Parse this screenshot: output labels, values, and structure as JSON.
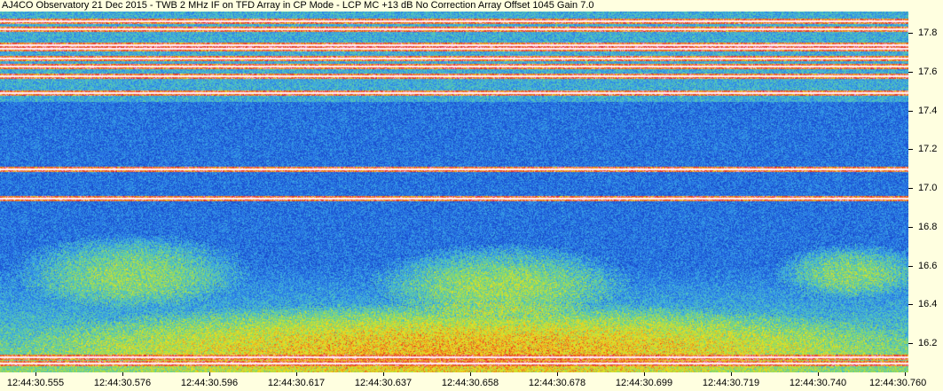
{
  "title": "AJ4CO Observatory 21 Dec 2015 - TWB 2 MHz IF on TFD Array in CP Mode - LCP  MC +13 dB  No Correction Array  Offset 1045  Gain 7.0",
  "chart_data": {
    "type": "heatmap",
    "title": "AJ4CO Observatory 21 Dec 2015 - TWB 2 MHz IF on TFD Array in CP Mode - LCP  MC +13 dB  No Correction Array  Offset 1045  Gain 7.0",
    "xlabel": "",
    "ylabel": "",
    "x_tick_labels": [
      "12:44:30.555",
      "12:44:30.576",
      "12:44:30.596",
      "12:44:30.617",
      "12:44:30.637",
      "12:44:30.658",
      "12:44:30.678",
      "12:44:30.699",
      "12:44:30.719",
      "12:44:30.740",
      "12:44:30.760"
    ],
    "y_tick_labels": [
      "17.8",
      "17.6",
      "17.4",
      "17.2",
      "17.0",
      "16.8",
      "16.6",
      "16.4",
      "16.2"
    ],
    "y_ticks": [
      17.8,
      17.6,
      17.4,
      17.2,
      17.0,
      16.8,
      16.6,
      16.4,
      16.2
    ],
    "ylim": [
      16.05,
      17.91
    ],
    "colormap": [
      "#1030a0",
      "#1a4fd0",
      "#2a7ae8",
      "#3fb0e0",
      "#60d0a0",
      "#b0e040",
      "#f0e020",
      "#f08020",
      "#e02020",
      "#ffc0e0",
      "#ffffff"
    ],
    "horizontal_lines_freq": [
      17.86,
      17.82,
      17.74,
      17.72,
      17.67,
      17.63,
      17.58,
      17.49,
      17.1,
      16.95,
      16.13,
      16.1
    ],
    "emission_regions": [
      {
        "time_start": "12:44:30.555",
        "time_end": "12:44:30.600",
        "freq_low": 16.45,
        "freq_high": 16.7
      },
      {
        "time_start": "12:44:30.640",
        "time_end": "12:44:30.690",
        "freq_low": 16.4,
        "freq_high": 16.65
      },
      {
        "time_start": "12:44:30.735",
        "time_end": "12:44:30.760",
        "freq_low": 16.5,
        "freq_high": 16.65
      },
      {
        "time_start": "12:44:30.555",
        "time_end": "12:44:30.760",
        "freq_low": 16.05,
        "freq_high": 16.35
      }
    ],
    "grid": false
  }
}
